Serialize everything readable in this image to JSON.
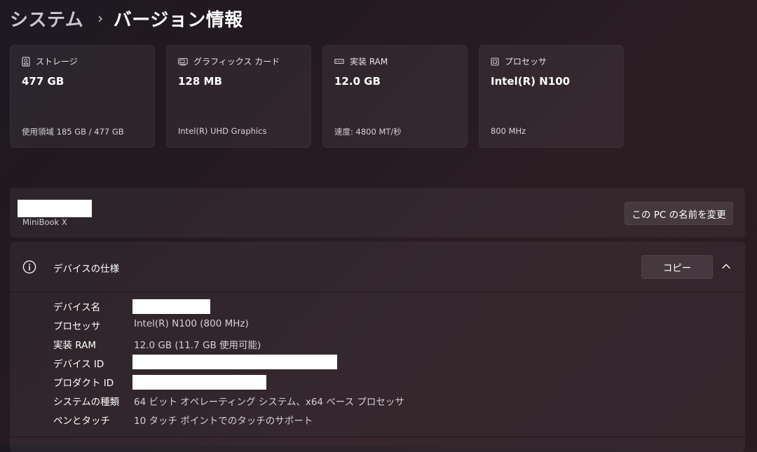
{
  "breadcrumb": {
    "parent": "システム",
    "separator": "›",
    "current": "バージョン情報"
  },
  "cards": [
    {
      "icon": "storage-icon",
      "label": "ストレージ",
      "value": "477 GB",
      "detail": "使用領域 185 GB / 477 GB"
    },
    {
      "icon": "graphics-card-icon",
      "label": "グラフィックス カード",
      "value": "128 MB",
      "detail": "Intel(R) UHD Graphics"
    },
    {
      "icon": "ram-icon",
      "label": "実装 RAM",
      "value": "12.0 GB",
      "detail": "速度: 4800 MT/秒"
    },
    {
      "icon": "processor-icon",
      "label": "プロセッサ",
      "value": "Intel(R) N100",
      "detail": "800 MHz"
    }
  ],
  "device_name_panel": {
    "model": "MiniBook X",
    "rename_label": "この PC の名前を変更"
  },
  "specs": {
    "title": "デバイスの仕様",
    "copy_label": "コピー",
    "rows": [
      {
        "key": "デバイス名",
        "value": ""
      },
      {
        "key": "プロセッサ",
        "value": "Intel(R) N100 (800 MHz)"
      },
      {
        "key": "実装 RAM",
        "value": "12.0 GB (11.7 GB 使用可能)"
      },
      {
        "key": "デバイス ID",
        "value": ""
      },
      {
        "key": "プロダクト ID",
        "value": ""
      },
      {
        "key": "システムの種類",
        "value": "64 ビット オペレーティング システム、x64 ベース プロセッサ"
      },
      {
        "key": "ペンとタッチ",
        "value": "10 タッチ ポイントでのタッチのサポート"
      }
    ]
  },
  "colors": {
    "background": "#231a20",
    "card": "#2e262c",
    "text_primary": "#ffffff",
    "text_secondary": "#d5d1d7"
  }
}
